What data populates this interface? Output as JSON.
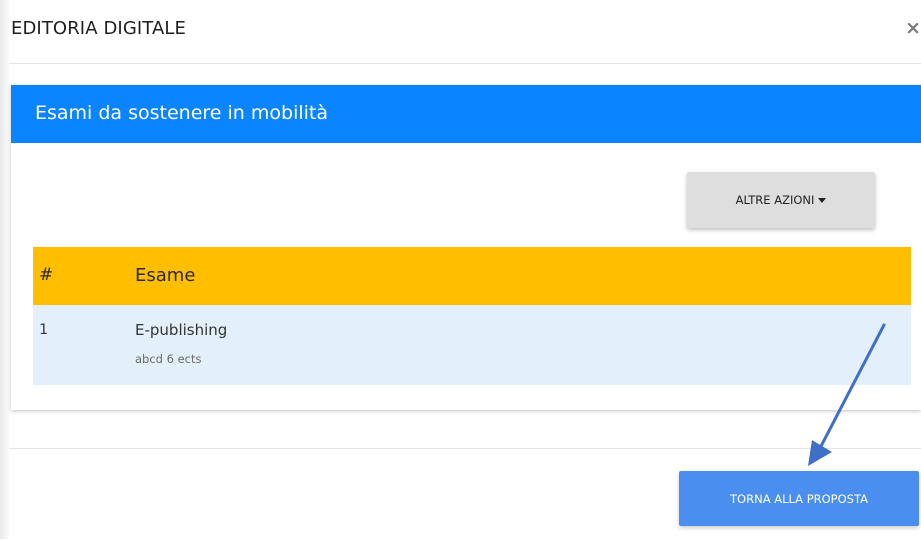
{
  "modal": {
    "title": "EDITORIA DIGITALE",
    "close_symbol": "×"
  },
  "card": {
    "title": "Esami da sostenere in mobilità",
    "actions_label": "ALTRE AZIONI"
  },
  "table": {
    "headers": [
      "#",
      "Esame"
    ],
    "rows": [
      {
        "num": "1",
        "name": "E-publishing",
        "detail": "abcd 6 ects"
      }
    ]
  },
  "footer": {
    "back_label": "TORNA ALLA PROPOSTA"
  },
  "colors": {
    "card_header": "#0a84ff",
    "table_header": "#ffbe00",
    "row_bg": "#e3f0fb",
    "primary_button": "#4a8ff0",
    "annotation_arrow": "#3f6fc6"
  },
  "icons": {
    "close": "close-icon",
    "caret": "caret-down-icon",
    "annotation": "annotation-arrow-icon"
  }
}
